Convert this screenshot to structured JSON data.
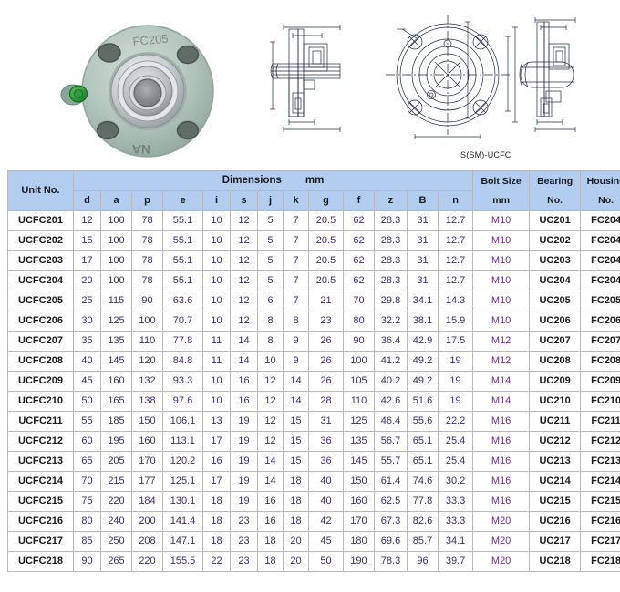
{
  "figures": {
    "photo": {
      "label": "FC205",
      "brand_mark": "NA",
      "alt": "flange-cartridge-bearing-unit-photo"
    },
    "drawing_caption": "S(SM)-UCFC"
  },
  "table": {
    "headers": {
      "unit_no": "Unit No.",
      "dimensions_group": "Dimensions",
      "dimensions_unit": "mm",
      "bolt_size": "Bolt Size",
      "bolt_size_unit": "mm",
      "bearing_no": "Bearing",
      "bearing_no_l2": "No.",
      "housing_no": "Housing",
      "housing_no_l2": "No.",
      "sub": [
        "d",
        "a",
        "p",
        "e",
        "i",
        "s",
        "j",
        "k",
        "g",
        "f",
        "z",
        "B",
        "n"
      ]
    },
    "rows": [
      {
        "unit": "UCFC201",
        "dims": [
          "12",
          "100",
          "78",
          "55.1",
          "10",
          "12",
          "5",
          "7",
          "20.5",
          "62",
          "28.3",
          "31",
          "12.7"
        ],
        "bolt": "M10",
        "bearing": "UC201",
        "housing": "FC204"
      },
      {
        "unit": "UCFC202",
        "dims": [
          "15",
          "100",
          "78",
          "55.1",
          "10",
          "12",
          "5",
          "7",
          "20.5",
          "62",
          "28.3",
          "31",
          "12.7"
        ],
        "bolt": "M10",
        "bearing": "UC202",
        "housing": "FC204"
      },
      {
        "unit": "UCFC203",
        "dims": [
          "17",
          "100",
          "78",
          "55.1",
          "10",
          "12",
          "5",
          "7",
          "20.5",
          "62",
          "28.3",
          "31",
          "12.7"
        ],
        "bolt": "M10",
        "bearing": "UC203",
        "housing": "FC204"
      },
      {
        "unit": "UCFC204",
        "dims": [
          "20",
          "100",
          "78",
          "55.1",
          "10",
          "12",
          "5",
          "7",
          "20.5",
          "62",
          "28.3",
          "31",
          "12.7"
        ],
        "bolt": "M10",
        "bearing": "UC204",
        "housing": "FC204"
      },
      {
        "unit": "UCFC205",
        "dims": [
          "25",
          "115",
          "90",
          "63.6",
          "10",
          "12",
          "6",
          "7",
          "21",
          "70",
          "29.8",
          "34.1",
          "14.3"
        ],
        "bolt": "M10",
        "bearing": "UC205",
        "housing": "FC205"
      },
      {
        "unit": "UCFC206",
        "dims": [
          "30",
          "125",
          "100",
          "70.7",
          "10",
          "12",
          "8",
          "8",
          "23",
          "80",
          "32.2",
          "38.1",
          "15.9"
        ],
        "bolt": "M10",
        "bearing": "UC206",
        "housing": "FC206"
      },
      {
        "unit": "UCFC207",
        "dims": [
          "35",
          "135",
          "110",
          "77.8",
          "11",
          "14",
          "8",
          "9",
          "26",
          "90",
          "36.4",
          "42.9",
          "17.5"
        ],
        "bolt": "M12",
        "bearing": "UC207",
        "housing": "FC207"
      },
      {
        "unit": "UCFC208",
        "dims": [
          "40",
          "145",
          "120",
          "84.8",
          "11",
          "14",
          "10",
          "9",
          "26",
          "100",
          "41.2",
          "49.2",
          "19"
        ],
        "bolt": "M12",
        "bearing": "UC208",
        "housing": "FC208"
      },
      {
        "unit": "UCFC209",
        "dims": [
          "45",
          "160",
          "132",
          "93.3",
          "10",
          "16",
          "12",
          "14",
          "26",
          "105",
          "40.2",
          "49.2",
          "19"
        ],
        "bolt": "M14",
        "bearing": "UC209",
        "housing": "FC209"
      },
      {
        "unit": "UCFC210",
        "dims": [
          "50",
          "165",
          "138",
          "97.6",
          "10",
          "16",
          "12",
          "14",
          "28",
          "110",
          "42.6",
          "51.6",
          "19"
        ],
        "bolt": "M14",
        "bearing": "UC210",
        "housing": "FC210"
      },
      {
        "unit": "UCFC211",
        "dims": [
          "55",
          "185",
          "150",
          "106.1",
          "13",
          "19",
          "12",
          "15",
          "31",
          "125",
          "46.4",
          "55.6",
          "22.2"
        ],
        "bolt": "M16",
        "bearing": "UC211",
        "housing": "FC211"
      },
      {
        "unit": "UCFC212",
        "dims": [
          "60",
          "195",
          "160",
          "113.1",
          "17",
          "19",
          "12",
          "15",
          "36",
          "135",
          "56.7",
          "65.1",
          "25.4"
        ],
        "bolt": "M16",
        "bearing": "UC212",
        "housing": "FC212"
      },
      {
        "unit": "UCFC213",
        "dims": [
          "65",
          "205",
          "170",
          "120.2",
          "16",
          "19",
          "14",
          "15",
          "36",
          "145",
          "55.7",
          "65.1",
          "25.4"
        ],
        "bolt": "M16",
        "bearing": "UC213",
        "housing": "FC213"
      },
      {
        "unit": "UCFC214",
        "dims": [
          "70",
          "215",
          "177",
          "125.1",
          "17",
          "19",
          "14",
          "18",
          "40",
          "150",
          "61.4",
          "74.6",
          "30.2"
        ],
        "bolt": "M16",
        "bearing": "UC214",
        "housing": "FC214"
      },
      {
        "unit": "UCFC215",
        "dims": [
          "75",
          "220",
          "184",
          "130.1",
          "18",
          "19",
          "16",
          "18",
          "40",
          "160",
          "62.5",
          "77.8",
          "33.3"
        ],
        "bolt": "M16",
        "bearing": "UC215",
        "housing": "FC215"
      },
      {
        "unit": "UCFC216",
        "dims": [
          "80",
          "240",
          "200",
          "141.4",
          "18",
          "23",
          "16",
          "18",
          "42",
          "170",
          "67.3",
          "82.6",
          "33.3"
        ],
        "bolt": "M20",
        "bearing": "UC216",
        "housing": "FC216"
      },
      {
        "unit": "UCFC217",
        "dims": [
          "85",
          "250",
          "208",
          "147.1",
          "18",
          "23",
          "18",
          "20",
          "45",
          "180",
          "69.6",
          "85.7",
          "34.1"
        ],
        "bolt": "M20",
        "bearing": "UC217",
        "housing": "FC217"
      },
      {
        "unit": "UCFC218",
        "dims": [
          "90",
          "265",
          "220",
          "155.5",
          "22",
          "23",
          "18",
          "20",
          "50",
          "190",
          "78.3",
          "96",
          "39.7"
        ],
        "bolt": "M20",
        "bearing": "UC218",
        "housing": "FC218"
      }
    ]
  },
  "colors": {
    "header_bg": "#b2cdf0",
    "border": "#b8b8b8",
    "number_text": "#3b2a6b",
    "bolt_text": "#6b2e8f",
    "code_text": "#1a1a1a"
  }
}
